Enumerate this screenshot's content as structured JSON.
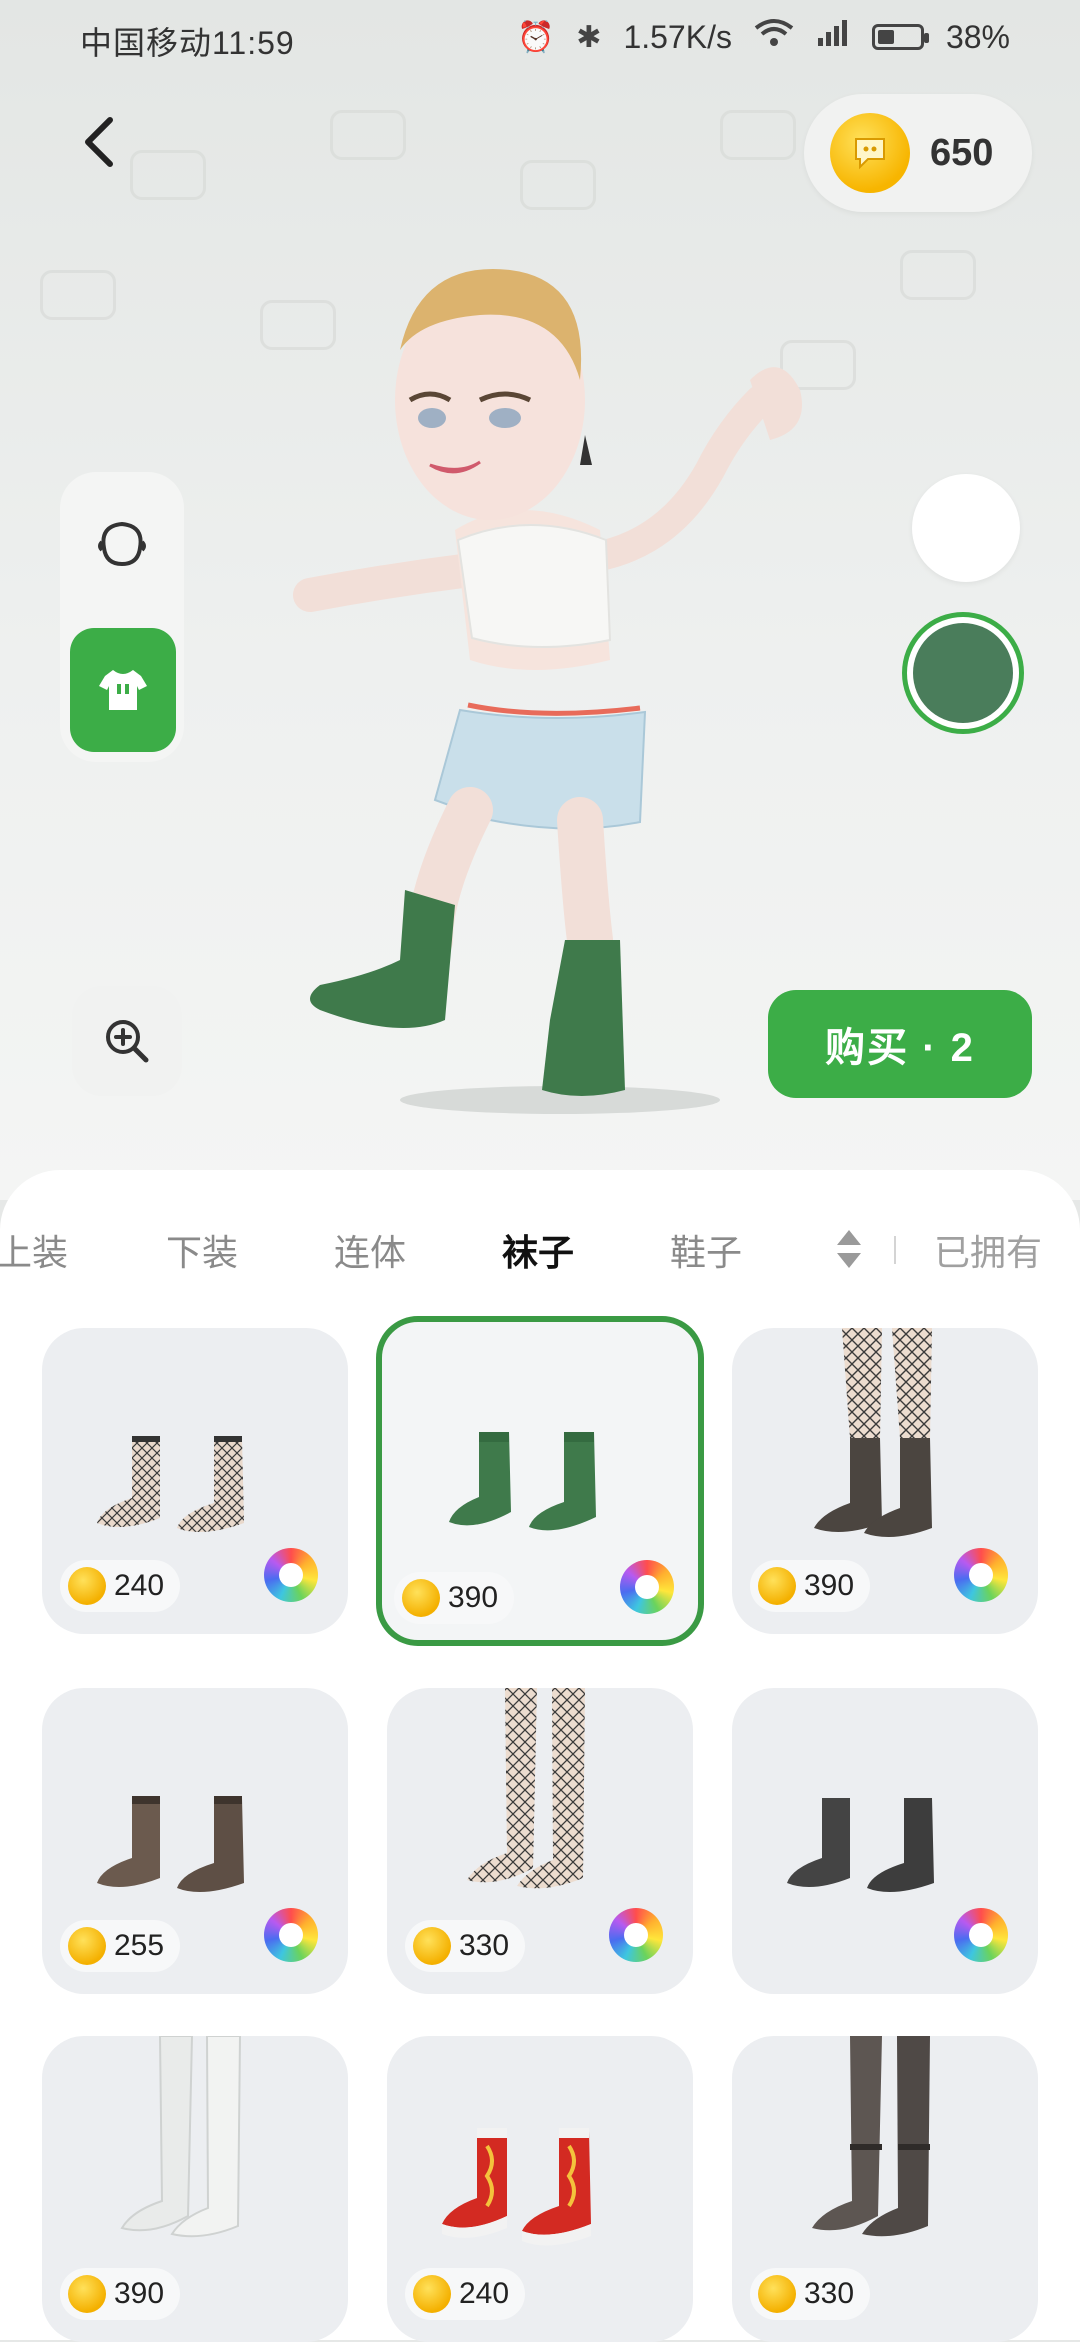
{
  "status_bar": {
    "carrier_time": "中国移动11:59",
    "network_speed": "1.57K/s",
    "battery": "38%"
  },
  "header": {
    "coin_balance": "650"
  },
  "scene": {
    "buy_button_label": "购买 · 2",
    "color_swatches": [
      "#ffffff",
      "#4a7d5b"
    ]
  },
  "tabs": {
    "items": [
      "上装",
      "下装",
      "连体",
      "袜子",
      "鞋子"
    ],
    "active": "袜子",
    "owned_label": "已拥有"
  },
  "items": [
    {
      "price": "240",
      "style": "fishnet-beige"
    },
    {
      "price": "390",
      "style": "green",
      "selected": true
    },
    {
      "price": "390",
      "style": "fishnet-dark-tall"
    },
    {
      "price": "255",
      "style": "brown-sheer"
    },
    {
      "price": "330",
      "style": "fishnet-beige-tall"
    },
    {
      "price": "",
      "style": "black"
    },
    {
      "price": "390",
      "style": "white-tall"
    },
    {
      "price": "240",
      "style": "red-pattern"
    },
    {
      "price": "330",
      "style": "black-sheer-tall"
    }
  ],
  "colors": {
    "accent_green": "#3cad47",
    "coin_yellow": "#f7b500"
  }
}
